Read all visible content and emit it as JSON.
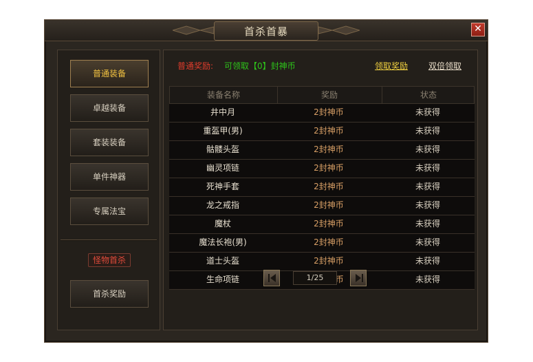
{
  "window": {
    "title": "首杀首暴",
    "close_label": "✕"
  },
  "sidebar": {
    "items": [
      {
        "label": "普通装备",
        "active": true
      },
      {
        "label": "卓越装备",
        "active": false
      },
      {
        "label": "套装装备",
        "active": false
      },
      {
        "label": "单件神器",
        "active": false
      },
      {
        "label": "专属法宝",
        "active": false
      }
    ],
    "monster_badge": "怪物首杀",
    "first_kill_reward": "首杀奖励"
  },
  "reward_bar": {
    "label": "普通奖励:",
    "value": "可领取【0】封神币",
    "claim_link": "领取奖励",
    "double_link": "双倍领取"
  },
  "table": {
    "headers": [
      "装备名称",
      "奖励",
      "状态"
    ],
    "rows": [
      {
        "name": "井中月",
        "reward": "2封神币",
        "status": "未获得"
      },
      {
        "name": "重盔甲(男)",
        "reward": "2封神币",
        "status": "未获得"
      },
      {
        "name": "骷髅头盔",
        "reward": "2封神币",
        "status": "未获得"
      },
      {
        "name": "幽灵项链",
        "reward": "2封神币",
        "status": "未获得"
      },
      {
        "name": "死神手套",
        "reward": "2封神币",
        "status": "未获得"
      },
      {
        "name": "龙之戒指",
        "reward": "2封神币",
        "status": "未获得"
      },
      {
        "name": "魔杖",
        "reward": "2封神币",
        "status": "未获得"
      },
      {
        "name": "魔法长袍(男)",
        "reward": "2封神币",
        "status": "未获得"
      },
      {
        "name": "道士头盔",
        "reward": "2封神币",
        "status": "未获得"
      },
      {
        "name": "生命项链",
        "reward": "2封神币",
        "status": "未获得"
      }
    ]
  },
  "pager": {
    "display": "1/25"
  },
  "colors": {
    "accent_gold": "#f0c040",
    "reward_red": "#e03c2c",
    "reward_green": "#2ec41a",
    "reward_amount": "#d9a066",
    "close_red": "#c0392b"
  }
}
